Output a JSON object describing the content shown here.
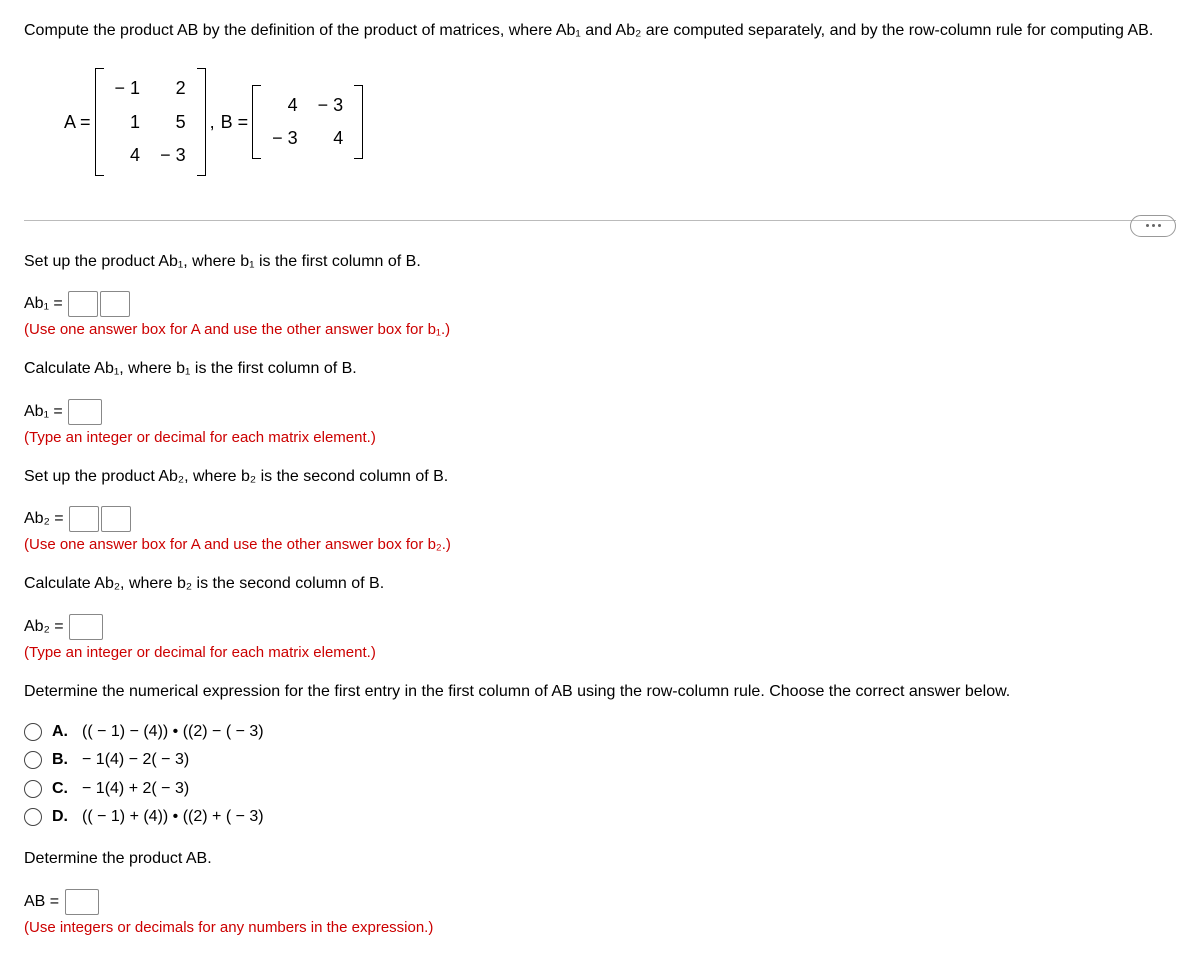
{
  "intro": "Compute the product AB by the definition of the product of matrices, where Ab₁ and Ab₂ are computed separately, and by the row-column rule for computing AB.",
  "matrices": {
    "A_label": "A =",
    "A": [
      [
        "− 1",
        "2"
      ],
      [
        "1",
        "5"
      ],
      [
        "4",
        "− 3"
      ]
    ],
    "comma": ",",
    "B_label": "B =",
    "B": [
      [
        "4",
        "− 3"
      ],
      [
        "− 3",
        "4"
      ]
    ]
  },
  "q1": {
    "prompt": "Set up the product Ab₁, where b₁ is the first column of B.",
    "lhs": "Ab₁ =",
    "hint": "(Use one answer box for A and use the other answer box for b₁.)"
  },
  "q2": {
    "prompt": "Calculate Ab₁, where b₁ is the first column of B.",
    "lhs": "Ab₁ =",
    "hint": "(Type an integer or decimal for each matrix element.)"
  },
  "q3": {
    "prompt": "Set up the product Ab₂, where b₂ is the second column of B.",
    "lhs": "Ab₂ =",
    "hint": "(Use one answer box for A and use the other answer box for b₂.)"
  },
  "q4": {
    "prompt": "Calculate Ab₂, where b₂ is the second column of B.",
    "lhs": "Ab₂ =",
    "hint": "(Type an integer or decimal for each matrix element.)"
  },
  "q5": {
    "prompt": "Determine the numerical expression for the first entry in the first column of AB using the row-column rule. Choose the correct answer below.",
    "choices": {
      "A": "(( − 1) − (4)) • ((2) − ( − 3)",
      "B": "− 1(4) − 2( − 3)",
      "C": "− 1(4) + 2( − 3)",
      "D": "(( − 1) + (4)) • ((2) + ( − 3)"
    }
  },
  "q6": {
    "prompt": "Determine the product AB.",
    "lhs": "AB =",
    "hint": "(Use integers or decimals for any numbers in the expression.)"
  },
  "labels": {
    "A": "A.",
    "B": "B.",
    "C": "C.",
    "D": "D."
  }
}
